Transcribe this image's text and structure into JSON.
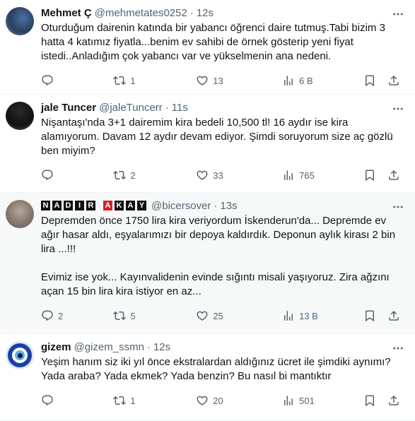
{
  "tweets": [
    {
      "name": "Mehmet Ç",
      "handle": "@mehmetates0252",
      "time": "12s",
      "text": "Oturduğum dairenin katında bir yabancı öğrenci daire tutmuş.Tabi bizim 3 hatta 4 katımız fiyatla...benim ev sahibi de örnek gösterip yeni fiyat istedi..Anladığım çok yabancı var ve yükselmenin ana nedeni.",
      "replies": "",
      "reposts": "1",
      "likes": "13",
      "views": "6 B"
    },
    {
      "name": "jale Tuncer",
      "handle": "@jaleTuncerr",
      "time": "11s",
      "text": "Nişantaşı'nda 3+1 dairemim kira bedeli 10,500 tl! 16 aydır ise kira alamıyorum. Davam 12 aydır devam ediyor. Şimdi soruyorum size aç gözlü ben miyim?",
      "replies": "",
      "reposts": "2",
      "likes": "33",
      "views": "765"
    },
    {
      "name_letters_1": [
        "N",
        "A",
        "D",
        "I",
        "R"
      ],
      "name_letters_2": [
        "A",
        "K",
        "A",
        "Y"
      ],
      "handle": "@bicersover",
      "time": "13s",
      "text": "Depremden önce 1750 lira kira veriyordum İskenderun'da... Depremde ev ağır hasar aldı, eşyalarımızı bir depoya kaldırdık. Deponun aylık kirası 2 bin lira ...!!!\n\nEvimiz ise yok... Kayınvalidenin evinde sığıntı misali yaşıyoruz. Zira ağzını açan 15 bin lira kira istiyor en az...",
      "replies": "2",
      "reposts": "5",
      "likes": "25",
      "views": "13 B"
    },
    {
      "name": "gizem",
      "handle": "@gizem_ssmn",
      "time": "12s",
      "text": "Yeşim hanım siz iki yıl önce ekstralardan aldığınız ücret ile şimdiki aynımı? Yada araba? Yada ekmek? Yada benzin? Bu nasıl bi mantıktır",
      "replies": "",
      "reposts": "1",
      "likes": "20",
      "views": "501"
    }
  ],
  "separator": "·",
  "colors": {
    "text": "#0f1419",
    "muted": "#536471",
    "border": "#eff3f4",
    "highlight_bg": "#f7f9f9",
    "brand_red": "#d91f26"
  }
}
